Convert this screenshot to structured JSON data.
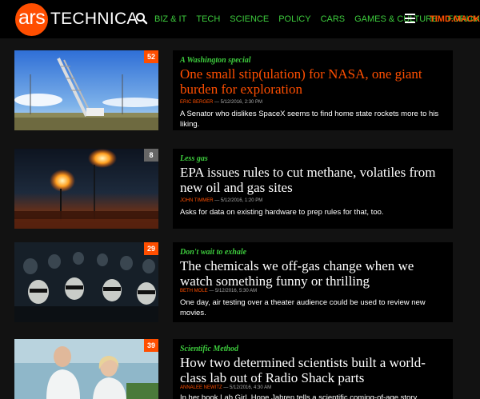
{
  "header": {
    "logo_ars": "ars",
    "logo_technica": "TECHNICA",
    "nav": [
      "BIZ & IT",
      "TECH",
      "SCIENCE",
      "POLICY",
      "CARS",
      "GAMES & CULTURE",
      "FORUMS"
    ],
    "user": "TIMD.MACKEY"
  },
  "colors": {
    "accent": "#ff4e00",
    "kicker": "#3dcc3d",
    "background": "#121212"
  },
  "articles": [
    {
      "comments": "52",
      "kicker": "A Washington special",
      "title": "One small stip(ulation) for NASA, one giant burden for exploration",
      "author": "ERIC BERGER",
      "date": "— 5/12/2016, 2:30 PM",
      "excerpt": "A Senator who dislikes SpaceX seems to find home state rockets more to his liking."
    },
    {
      "comments": "8",
      "kicker": "Less gas",
      "title": "EPA issues rules to cut methane, volatiles from new oil and gas sites",
      "author": "JOHN TIMMER",
      "date": "— 5/12/2016, 1:20 PM",
      "excerpt": "Asks for data on existing hardware to prep rules for that, too."
    },
    {
      "comments": "29",
      "kicker": "Don't wait to exhale",
      "title": "The chemicals we off-gas change when we watch something funny or thrilling",
      "author": "BETH MOLE",
      "date": "— 5/12/2016, 5:30 AM",
      "excerpt": "One day, air testing over a theater audience could be used to review new movies."
    },
    {
      "comments": "39",
      "kicker": "Scientific Method",
      "title": "How two determined scientists built a world-class lab out of Radio Shack parts",
      "author": "ANNALEE NEWITZ",
      "date": "— 5/12/2016, 4:30 AM",
      "excerpt": "In her book Lab Girl, Hope Jahren tells a scientific coming-of-age story."
    }
  ]
}
